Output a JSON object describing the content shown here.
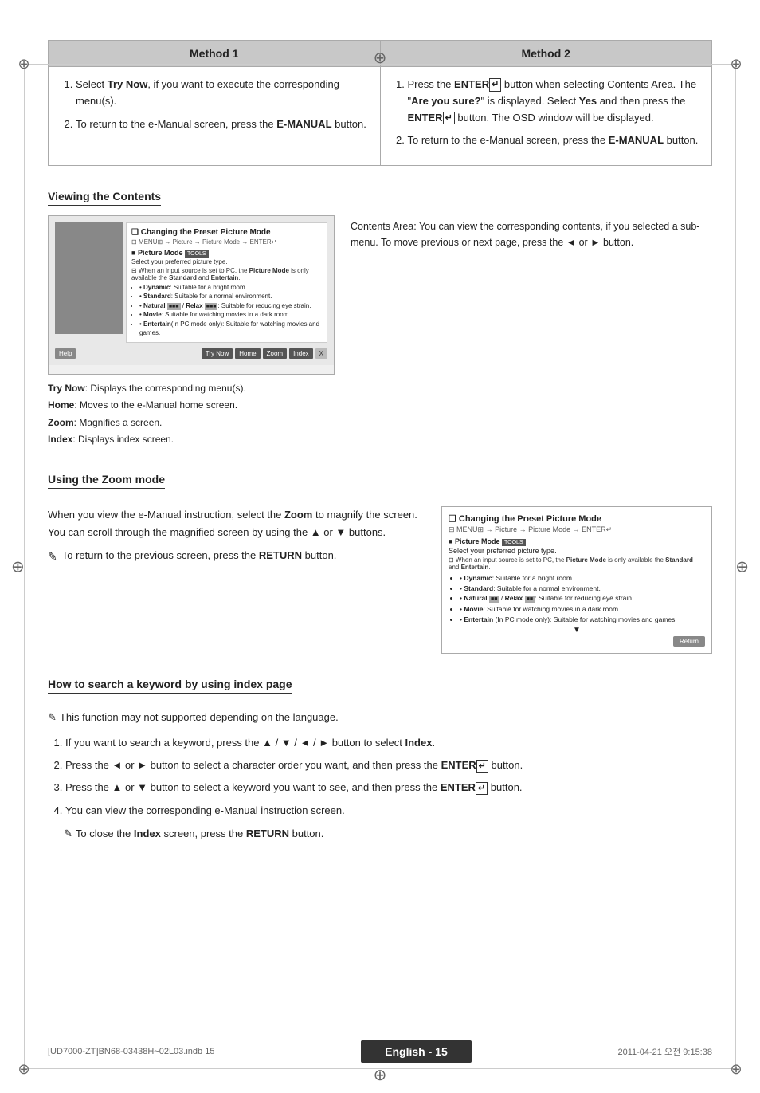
{
  "page": {
    "title": "English - 15",
    "footer_left": "[UD7000-ZT]BN68-03438H~02L03.indb   15",
    "footer_center": "English - 15",
    "footer_right": "2011-04-21   오전 9:15:38"
  },
  "methods": {
    "method1_header": "Method 1",
    "method2_header": "Method 2",
    "method1_steps": [
      "Select Try Now, if you want to execute the corresponding menu(s).",
      "To return to the e-Manual screen, press the E-MANUAL button."
    ],
    "method2_steps": [
      "Press the ENTER button when selecting Contents Area. The \"Are you sure?\" is displayed. Select Yes and then press the ENTER button. The OSD window will be displayed.",
      "To return to the e-Manual screen, press the E-MANUAL button."
    ]
  },
  "viewing_section": {
    "heading": "Viewing the Contents",
    "screenshot": {
      "title": "Changing the Preset Picture Mode",
      "path": "MENU → Picture → Picture Mode → ENTER",
      "mode_label": "Picture Mode",
      "tools_badge": "TOOLS",
      "select_text": "Select your preferred picture type.",
      "note_text": "When an input source is set to PC, the Picture Mode is only available the Standard and Entertain.",
      "items": [
        "Dynamic: Suitable for a bright room.",
        "Standard: Suitable for a normal environment.",
        "Natural / Relax: Suitable for reducing eye strain.",
        "Movie: Suitable for watching movies in a dark room.",
        "Entertain(In PC mode only): Suitable for watching movies and games."
      ],
      "buttons": [
        "Try Now",
        "Home",
        "Zoom",
        "Index",
        "X"
      ],
      "help_btn": "Help"
    },
    "captions": [
      "Try Now: Displays the corresponding menu(s).",
      "Home: Moves to the e-Manual home screen.",
      "Zoom: Magnifies a screen.",
      "Index: Displays index screen."
    ],
    "description": "Contents Area: You can view the corresponding contents, if you selected a sub-menu. To move previous or next page, press the ◄ or ► button."
  },
  "zoom_section": {
    "heading": "Using the Zoom mode",
    "text1": "When you view the e-Manual instruction, select the Zoom to magnify the screen. You can scroll through the magnified screen by using the ▲ or ▼ buttons.",
    "note": "To return to the previous screen, press the RETURN button.",
    "screenshot": {
      "title": "Changing the Preset Picture Mode",
      "path": "MENU → Picture → Picture Mode → ENTER",
      "mode_label": "Picture Mode",
      "tools_badge": "TOOLS",
      "select_text": "Select your preferred picture type.",
      "note_text": "When an input source is set to PC, the Picture Mode is only available the Standard and Entertain.",
      "items": [
        "Dynamic: Suitable for a bright room.",
        "Standard: Suitable for a normal environment.",
        "Natural / Relax: Suitable for reducing eye strain.",
        "Movie: Suitable for watching movies in a dark room.",
        "Entertain (In PC mode only): Suitable for watching movies and games."
      ],
      "return_btn": "Return",
      "arrow_down": "▼"
    }
  },
  "index_section": {
    "heading": "How to search a keyword by using index page",
    "function_note": "This function may not supported depending on the language.",
    "steps": [
      "If you want to search a keyword, press the ▲ / ▼ / ◄ / ► button to select Index.",
      "Press the ◄ or ► button to select a character order you want, and then press the ENTER button.",
      "Press the ▲ or ▼ button to select a keyword you want to see, and then press the ENTER button.",
      "You can view the corresponding e-Manual instruction screen."
    ],
    "close_note": "To close the Index screen, press the RETURN button."
  }
}
